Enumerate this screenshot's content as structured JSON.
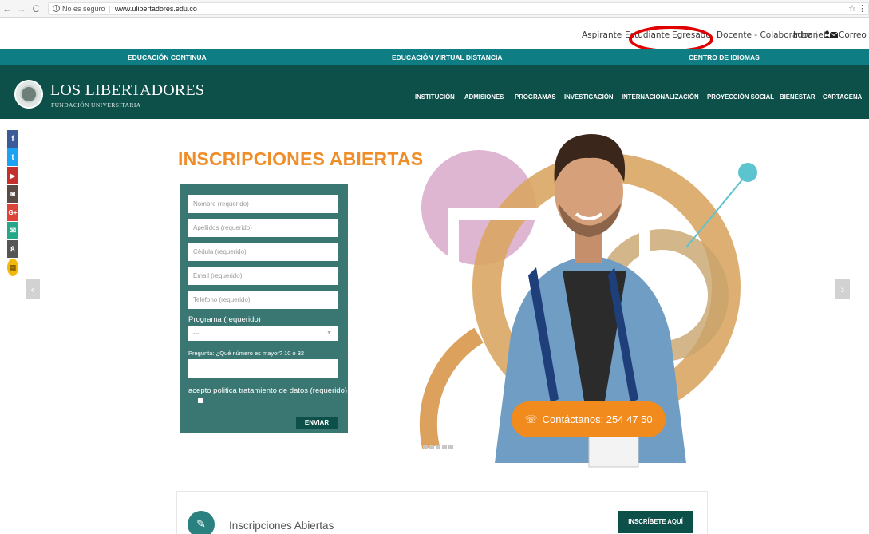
{
  "browser": {
    "back": "←",
    "forward": "→",
    "reload": "C",
    "security": "No es seguro",
    "separator": "|",
    "url": "www.ulibertadores.edu.co",
    "info_icon": "i",
    "star": "☆",
    "menu": "⋮"
  },
  "top_links": {
    "aspirante": "Aspirante",
    "estudiante": "Estudiante",
    "egresado": "Egresado",
    "docente": "Docente - Colaborador",
    "divider": "|",
    "intranet": "Intranet",
    "correo": "Correo"
  },
  "teal_bar": {
    "left": "EDUCACIÓN CONTINUA",
    "center": "EDUCACIÓN VIRTUAL DISTANCIA",
    "right": "CENTRO DE IDIOMAS"
  },
  "header": {
    "logo_name": "LOS LIBERTADORES",
    "logo_sub": "FUNDACIÓN UNIVERSITARIA",
    "nav": [
      "INSTITUCIÓN",
      "ADMISIONES",
      "PROGRAMAS",
      "INVESTIGACIÓN",
      "INTERNACIONALIZACIÓN",
      "PROYECCIÓN SOCIAL",
      "BIENESTAR",
      "CARTAGENA"
    ]
  },
  "social": {
    "facebook": "f",
    "twitter": "t",
    "youtube": "▶",
    "instagram": "◙",
    "googleplus": "G+",
    "email": "✉",
    "podcast": "ጰ",
    "chat": "▤"
  },
  "hero": {
    "title": "INSCRIPCIONES ABIERTAS",
    "prev_arrow": "‹",
    "next_arrow": "›",
    "cta_icon": "☏",
    "cta": "Contáctanos: 254 47 50"
  },
  "form": {
    "nombre_placeholder": "Nombre (requerido)",
    "apellidos_placeholder": "Apellidos (requerido)",
    "cedula_placeholder": "Cédula (requerido)",
    "email_placeholder": "Email (requerido)",
    "telefono_placeholder": "Teléfono (requerido)",
    "programa_label": "Programa (requerido)",
    "programa_value": "---",
    "pregunta_label": "Pregunta: ¿Qué número es mayor? 10 o 32",
    "politica_label": "acepto politica tratamiento de datos (requerido)",
    "submit": "ENVIAR"
  },
  "card": {
    "icon": "✎",
    "title": "Inscripciones Abiertas",
    "button": "INSCRÍBETE AQUÍ"
  },
  "colors": {
    "teal_bar": "#0f7d84",
    "header": "#0d4f49",
    "orange": "#ef8d28",
    "form_panel": "#3a7773",
    "annotation": "#e10000"
  }
}
